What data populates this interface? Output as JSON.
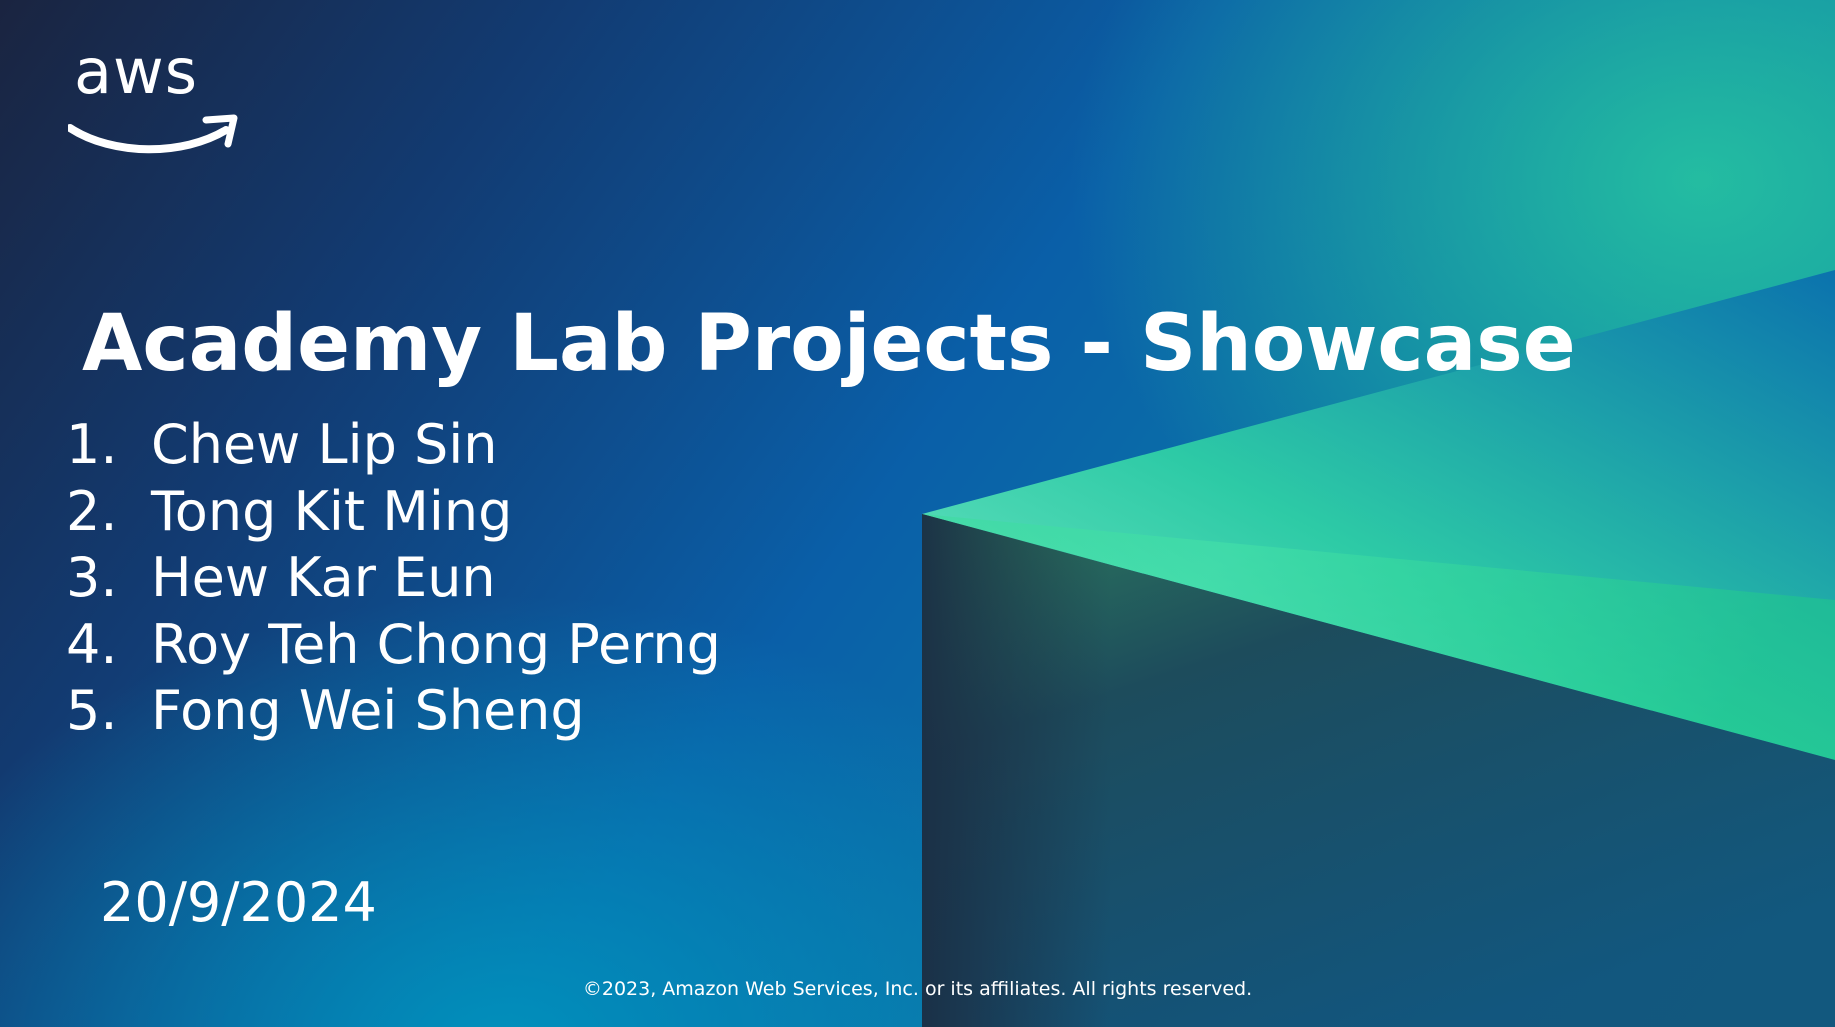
{
  "slide": {
    "logo_text": "aws",
    "title": "Academy Lab Projects - Showcase",
    "names": [
      {
        "number": "1.",
        "name": "Chew Lip Sin"
      },
      {
        "number": "2.",
        "name": "Tong Kit Ming"
      },
      {
        "number": "3.",
        "name": "Hew Kar Eun"
      },
      {
        "number": "4.",
        "name": "Roy Teh Chong Perng"
      },
      {
        "number": "5.",
        "name": "Fong Wei Sheng"
      }
    ],
    "date": "20/9/2024",
    "footer": "©2023, Amazon Web Services, Inc. or its affiliates. All rights reserved."
  },
  "colors": {
    "text": "#ffffff",
    "background_dark": "#1a2440",
    "background_blue": "#0a5fa8",
    "accent_green": "#2fd49a"
  },
  "icons": {
    "logo": "aws-smile-logo"
  }
}
